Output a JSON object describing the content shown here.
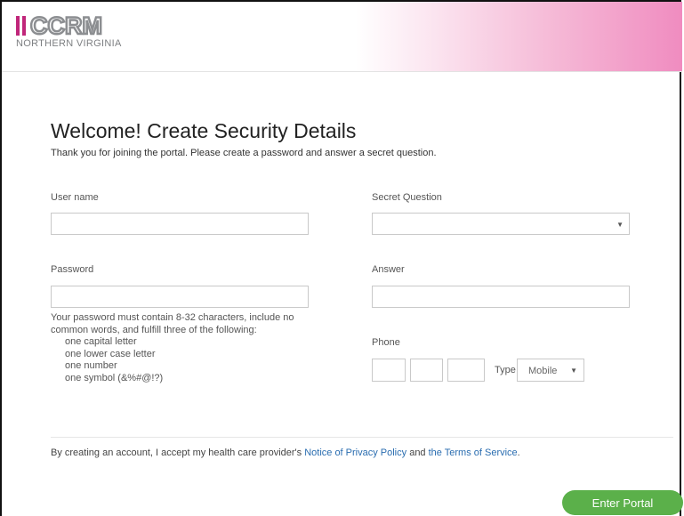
{
  "brand": {
    "logo_text": "CCRM",
    "logo_subtitle": "NORTHERN VIRGINIA",
    "accent_color": "#c0267a"
  },
  "page": {
    "title": "Welcome! Create Security Details",
    "intro": "Thank you for joining the portal. Please create a password and answer a secret question."
  },
  "form": {
    "username_label": "User name",
    "username_value": "",
    "password_label": "Password",
    "password_value": "",
    "password_rules_intro": "Your password must contain 8-32 characters, include no common words, and fulfill three of the following:",
    "password_rules": [
      "one capital letter",
      "one lower case letter",
      "one number",
      "one symbol (&%#@!?)"
    ],
    "secret_question_label": "Secret Question",
    "secret_question_value": "",
    "answer_label": "Answer",
    "answer_value": "",
    "phone_label": "Phone",
    "phone_type_label": "Type",
    "phone_type_value": "Mobile"
  },
  "footer": {
    "consent_prefix": "By creating an account, I accept my health care provider's ",
    "privacy_link": "Notice of Privacy Policy",
    "consent_and": " and ",
    "terms_link": "the Terms of Service",
    "consent_suffix": ".",
    "enter_button": "Enter Portal",
    "button_color": "#5bb04a"
  }
}
